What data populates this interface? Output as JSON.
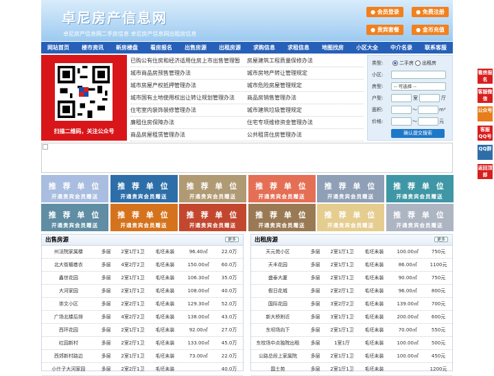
{
  "site": {
    "title": "卓尼房产信息网",
    "subtitle": "卓尼房产信息网二手房信息    卓尼房产信息网出租房信息"
  },
  "header_buttons": [
    "会员登录",
    "免费注册",
    "贵宾套餐",
    "金币充值"
  ],
  "nav": [
    "网站首页",
    "楼市资讯",
    "新房楼盘",
    "看房报名",
    "出售房源",
    "出租房源",
    "求购信息",
    "求租信息",
    "地图找房",
    "小区大全",
    "中介名录",
    "联系客服"
  ],
  "qr": {
    "caption": "扫描二维码，关注公众号"
  },
  "links": [
    [
      "已购公有住房和经济适用住房上市出售管理暂",
      "房屋建筑工程质量保修办法"
    ],
    [
      "城市商品房预售管理办法",
      "城市房地产转让管理规定"
    ],
    [
      "城市房屋产权抵押管理办法",
      "城市危险房屋管理规定"
    ],
    [
      "城市国有土地使用权出让转让规划管理办法",
      "商品房销售管理办法"
    ],
    [
      "住宅室内装饰装修管理办法",
      "城市建筑垃圾管理规定"
    ],
    [
      "廉租住房保障办法",
      "住宅专项维修资金管理办法"
    ],
    [
      "商品房屋租赁管理办法",
      "公共租赁住房管理办法"
    ]
  ],
  "search": {
    "type_label": "类型:",
    "opt_sale": "二手房",
    "opt_rent": "出租房",
    "xq_label": "小区:",
    "hx_label": "房型:",
    "hx_value": "-- 可选择 --",
    "hu_label": "户型:",
    "shi": "室",
    "ting": "厅",
    "area_label": "面积:",
    "price_label": "价格:",
    "sep": "～",
    "unit_area": "m²",
    "unit_price": "元",
    "submit": "确认提交搜索"
  },
  "promo": {
    "line1": "推 荐 单 位",
    "line2": "开通贵宾会员赠送",
    "colors": [
      "#a9bde0",
      "#2d6ea8",
      "#b09a73",
      "#e46f55",
      "#8e9fb6",
      "#3f97a6",
      "#5f8da3",
      "#d5731d",
      "#c3472f",
      "#9a7a55",
      "#e5cd8f",
      "#adb4c2"
    ]
  },
  "sale": {
    "title": "出售房源",
    "more": "更多",
    "rows": [
      [
        "州法院家属楼",
        "多层",
        "2室1厅1卫",
        "毛坯未装",
        "96.40㎡",
        "22.0万"
      ],
      [
        "北大街楣巷衣",
        "多层",
        "4室2厅2卫",
        "毛坯未装",
        "150.00㎡",
        "60.0万"
      ],
      [
        "鑫世花园",
        "多层",
        "2室1厅1卫",
        "毛坯未装",
        "106.30㎡",
        "35.0万"
      ],
      [
        "大河家园",
        "多层",
        "2室1厅1卫",
        "毛坯未装",
        "108.00㎡",
        "40.0万"
      ],
      [
        "崇文小区",
        "多层",
        "2室2厅1卫",
        "毛坯未装",
        "129.30㎡",
        "52.0万"
      ],
      [
        "广场北楼后排",
        "多层",
        "4室2厅2卫",
        "毛坯未装",
        "138.00㎡",
        "43.0万"
      ],
      [
        "西环花园",
        "多层",
        "2室1厅1卫",
        "毛坯未装",
        "92.00㎡",
        "27.0万"
      ],
      [
        "红园新村",
        "多层",
        "2室2厅1卫",
        "毛坯未装",
        "133.00㎡",
        "45.0万"
      ],
      [
        "西郊新村路边",
        "多层",
        "2室1厅1卫",
        "毛坯未装",
        "73.00㎡",
        "22.0万"
      ],
      [
        "小什子大河家园",
        "多层",
        "2室2厅1卫",
        "毛坯未装",
        "",
        "40.0万"
      ]
    ]
  },
  "rent": {
    "title": "出租房源",
    "more": "更多",
    "rows": [
      [
        "天元苑小区",
        "多层",
        "2室1厅1卫",
        "毛坯未装",
        "100.00㎡",
        "750元"
      ],
      [
        "天丰花园",
        "多层",
        "2室1厅1卫",
        "毛坯未装",
        "86.00㎡",
        "1100元"
      ],
      [
        "盛泰大厦",
        "多层",
        "2室1厅1卫",
        "毛坯未装",
        "90.00㎡",
        "750元"
      ],
      [
        "假日花城",
        "多层",
        "2室2厅1卫",
        "毛坯未装",
        "96.00㎡",
        "800元"
      ],
      [
        "国际花园",
        "多层",
        "3室2厅2卫",
        "毛坯未装",
        "139.00㎡",
        "700元"
      ],
      [
        "新大桥附近",
        "多层",
        "3室1厅1卫",
        "毛坯未装",
        "200.00㎡",
        "600元"
      ],
      [
        "东坝场向下",
        "多层",
        "2室1厅1卫",
        "毛坯未装",
        "70.00㎡",
        "550元"
      ],
      [
        "东校场中点独院出租",
        "多层",
        "1室1厅",
        "毛坯未装",
        "100.00㎡",
        "500元"
      ],
      [
        "公路总段上家属院",
        "多层",
        "2室1厅1卫",
        "毛坯未装",
        "100.00㎡",
        "450元"
      ],
      [
        "国土苑",
        "多层",
        "2室1厅1卫",
        "毛坯未装",
        "",
        "1200元"
      ]
    ]
  },
  "side": [
    {
      "text": "看房报名",
      "color": "#d81e1e"
    },
    {
      "text": "客服微信",
      "color": "#d81e1e"
    },
    {
      "text": "公众号",
      "color": "#e87d1c"
    },
    {
      "text": "客服QQ号",
      "color": "#d81e1e"
    },
    {
      "text": "QQ群",
      "color": "#2d6ea8"
    },
    {
      "text": "返回顶部",
      "color": "#d81e1e"
    }
  ]
}
